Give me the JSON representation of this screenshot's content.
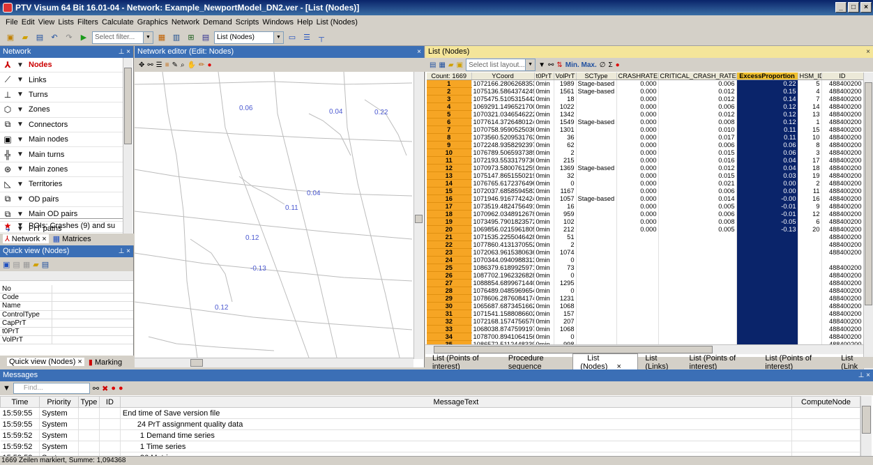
{
  "window": {
    "title": "PTV Visum 64 Bit 16.01-04 - Network: Example_NewportModel_DN2.ver - [List (Nodes)]"
  },
  "menu": [
    "File",
    "Edit",
    "View",
    "Lists",
    "Filters",
    "Calculate",
    "Graphics",
    "Network",
    "Demand",
    "Scripts",
    "Windows",
    "Help",
    "List (Nodes)"
  ],
  "toolbar": {
    "filter_placeholder": "Select filter...",
    "list_select": "List (Nodes)"
  },
  "network_panel": {
    "title": "Network",
    "items": [
      "Nodes",
      "Links",
      "Turns",
      "Zones",
      "Connectors",
      "Main nodes",
      "Main turns",
      "Main zones",
      "Territories",
      "OD pairs",
      "Main OD pairs",
      "PrT paths"
    ],
    "extra_item": "POIs: Crashes (9) and su",
    "tabs": [
      "Network",
      "Matrices"
    ]
  },
  "quick_view": {
    "title": "Quick view (Nodes)",
    "rows": [
      "No",
      "Code",
      "Name",
      "ControlType",
      "CapPrT",
      "t0PrT",
      "VolPrT"
    ],
    "tabs": [
      "Quick view (Nodes)",
      "Marking"
    ]
  },
  "net_editor": {
    "title": "Network editor (Edit: Nodes)",
    "labels": [
      "0.06",
      "0.04",
      "0.22",
      "0.04",
      "0.11",
      "0.12",
      "-0.13",
      "0.12"
    ]
  },
  "list": {
    "title": "List (Nodes)",
    "layout_placeholder": "Select list layout...",
    "headers": [
      "Count: 1669",
      "YCoord",
      "t0PrT",
      "VolPrT",
      "SCType",
      "CRASHRATE",
      "CRITICAL_CRASH_RATE",
      "ExcessProportion",
      "HSM_ID",
      "ID"
    ],
    "rows": [
      [
        "1",
        "1072166.2806268353",
        "0min",
        "1989",
        "Stage-based",
        "0.000",
        "0.006",
        "0.22",
        "5",
        "488400200"
      ],
      [
        "2",
        "1075136.5864374249",
        "0min",
        "1561",
        "Stage-based",
        "0.000",
        "0.012",
        "0.15",
        "4",
        "488400200"
      ],
      [
        "3",
        "1075475.5105315442",
        "0min",
        "18",
        "",
        "0.000",
        "0.012",
        "0.14",
        "7",
        "488400200"
      ],
      [
        "4",
        "1069291.1496521700",
        "0min",
        "1022",
        "",
        "0.000",
        "0.006",
        "0.12",
        "14",
        "488400200"
      ],
      [
        "5",
        "1070321.0346546222",
        "0min",
        "1342",
        "",
        "0.000",
        "0.012",
        "0.12",
        "13",
        "488400200"
      ],
      [
        "6",
        "1077614.3726480124",
        "0min",
        "1549",
        "Stage-based",
        "0.000",
        "0.008",
        "0.12",
        "1",
        "488400200"
      ],
      [
        "7",
        "1070758.9590525036",
        "0min",
        "1301",
        "",
        "0.000",
        "0.010",
        "0.11",
        "15",
        "488400200"
      ],
      [
        "8",
        "1073560.5209531763",
        "0min",
        "36",
        "",
        "0.000",
        "0.017",
        "0.11",
        "10",
        "488400200"
      ],
      [
        "9",
        "1072248.9358292397",
        "0min",
        "62",
        "",
        "0.000",
        "0.006",
        "0.06",
        "8",
        "488400200"
      ],
      [
        "10",
        "1076789.5065937389",
        "0min",
        "2",
        "",
        "0.000",
        "0.015",
        "0.06",
        "3",
        "488400200"
      ],
      [
        "11",
        "1072193.5533179736",
        "0min",
        "215",
        "",
        "0.000",
        "0.016",
        "0.04",
        "17",
        "488400200"
      ],
      [
        "12",
        "1070973.5800761259",
        "0min",
        "1369",
        "Stage-based",
        "0.000",
        "0.012",
        "0.04",
        "18",
        "488400200"
      ],
      [
        "13",
        "1075147.8651550219",
        "0min",
        "32",
        "",
        "0.000",
        "0.015",
        "0.03",
        "19",
        "488400200"
      ],
      [
        "14",
        "1076765.6172376496",
        "0min",
        "0",
        "",
        "0.000",
        "0.021",
        "0.00",
        "2",
        "488400200"
      ],
      [
        "15",
        "1072037.6858594583",
        "0min",
        "1167",
        "",
        "0.000",
        "0.006",
        "0.00",
        "11",
        "488400200"
      ],
      [
        "16",
        "1071946.9167742424",
        "0min",
        "1057",
        "Stage-based",
        "0.000",
        "0.014",
        "-0.00",
        "16",
        "488400200"
      ],
      [
        "17",
        "1073519.4824756491",
        "0min",
        "16",
        "",
        "0.000",
        "0.005",
        "-0.01",
        "9",
        "488400200"
      ],
      [
        "18",
        "1070962.0348912678",
        "0min",
        "959",
        "",
        "0.000",
        "0.006",
        "-0.01",
        "12",
        "488400200"
      ],
      [
        "19",
        "1073495.7901823572",
        "0min",
        "102",
        "",
        "0.000",
        "0.008",
        "-0.05",
        "6",
        "488400200"
      ],
      [
        "20",
        "1069856.0215961805",
        "0min",
        "212",
        "",
        "0.000",
        "0.005",
        "-0.13",
        "20",
        "488400200"
      ],
      [
        "21",
        "1071535.2255046428",
        "0min",
        "51",
        "",
        "",
        "",
        "",
        "",
        "488400200"
      ],
      [
        "22",
        "1077860.4131370552",
        "0min",
        "2",
        "",
        "",
        "",
        "",
        "",
        "488400200"
      ],
      [
        "23",
        "1072063.9615380636",
        "0min",
        "1074",
        "",
        "",
        "",
        "",
        "",
        "488400200"
      ],
      [
        "24",
        "1070344.0940988313",
        "0min",
        "0",
        "",
        "",
        "",
        "",
        "",
        ""
      ],
      [
        "25",
        "1086379.6189925971",
        "0min",
        "73",
        "",
        "",
        "",
        "",
        "",
        "488400200"
      ],
      [
        "26",
        "1087702.1962326828",
        "0min",
        "0",
        "",
        "",
        "",
        "",
        "",
        "488400200"
      ],
      [
        "27",
        "1088854.6899671440",
        "0min",
        "1295",
        "",
        "",
        "",
        "",
        "",
        "488400200"
      ],
      [
        "28",
        "1076489.0485969654",
        "0min",
        "0",
        "",
        "",
        "",
        "",
        "",
        "488400200"
      ],
      [
        "29",
        "1078606.2876084174",
        "0min",
        "1231",
        "",
        "",
        "",
        "",
        "",
        "488400200"
      ],
      [
        "30",
        "1065687.6873451662",
        "0min",
        "1068",
        "",
        "",
        "",
        "",
        "",
        "488400200"
      ],
      [
        "31",
        "1071541.1588086602",
        "0min",
        "157",
        "",
        "",
        "",
        "",
        "",
        "488400200"
      ],
      [
        "32",
        "1072168.1574756578",
        "0min",
        "207",
        "",
        "",
        "",
        "",
        "",
        "488400200"
      ],
      [
        "33",
        "1068038.8747599197",
        "0min",
        "1068",
        "",
        "",
        "",
        "",
        "",
        "488400200"
      ],
      [
        "34",
        "1078700.8941064156",
        "0min",
        "0",
        "",
        "",
        "",
        "",
        "",
        "488400200"
      ],
      [
        "35",
        "1086572.5112448339",
        "0min",
        "998",
        "",
        "",
        "",
        "",
        "",
        "488400200"
      ]
    ],
    "tabs": [
      "List (Points of interest)",
      "Procedure sequence",
      "List (Nodes)",
      "List (Links)",
      "List (Points of interest)",
      "List (Points of interest)",
      "List (Link"
    ]
  },
  "messages": {
    "title": "Messages",
    "find_placeholder": "Find...",
    "headers": [
      "Time",
      "Priority",
      "Type",
      "ID",
      "MessageText",
      "ComputeNode"
    ],
    "rows": [
      [
        "15:59:55",
        "System",
        "",
        "",
        "End time of Save version file",
        ""
      ],
      [
        "15:59:55",
        "System",
        "",
        "",
        "24 PrT assignment quality data",
        ""
      ],
      [
        "15:59:52",
        "System",
        "",
        "",
        "1 Demand time series",
        ""
      ],
      [
        "15:59:52",
        "System",
        "",
        "",
        "1 Time series",
        ""
      ],
      [
        "15:59:52",
        "System",
        "",
        "",
        "26 Matrices",
        ""
      ]
    ]
  },
  "status": "1669 Zeilen markiert, Summe: 1,094368"
}
